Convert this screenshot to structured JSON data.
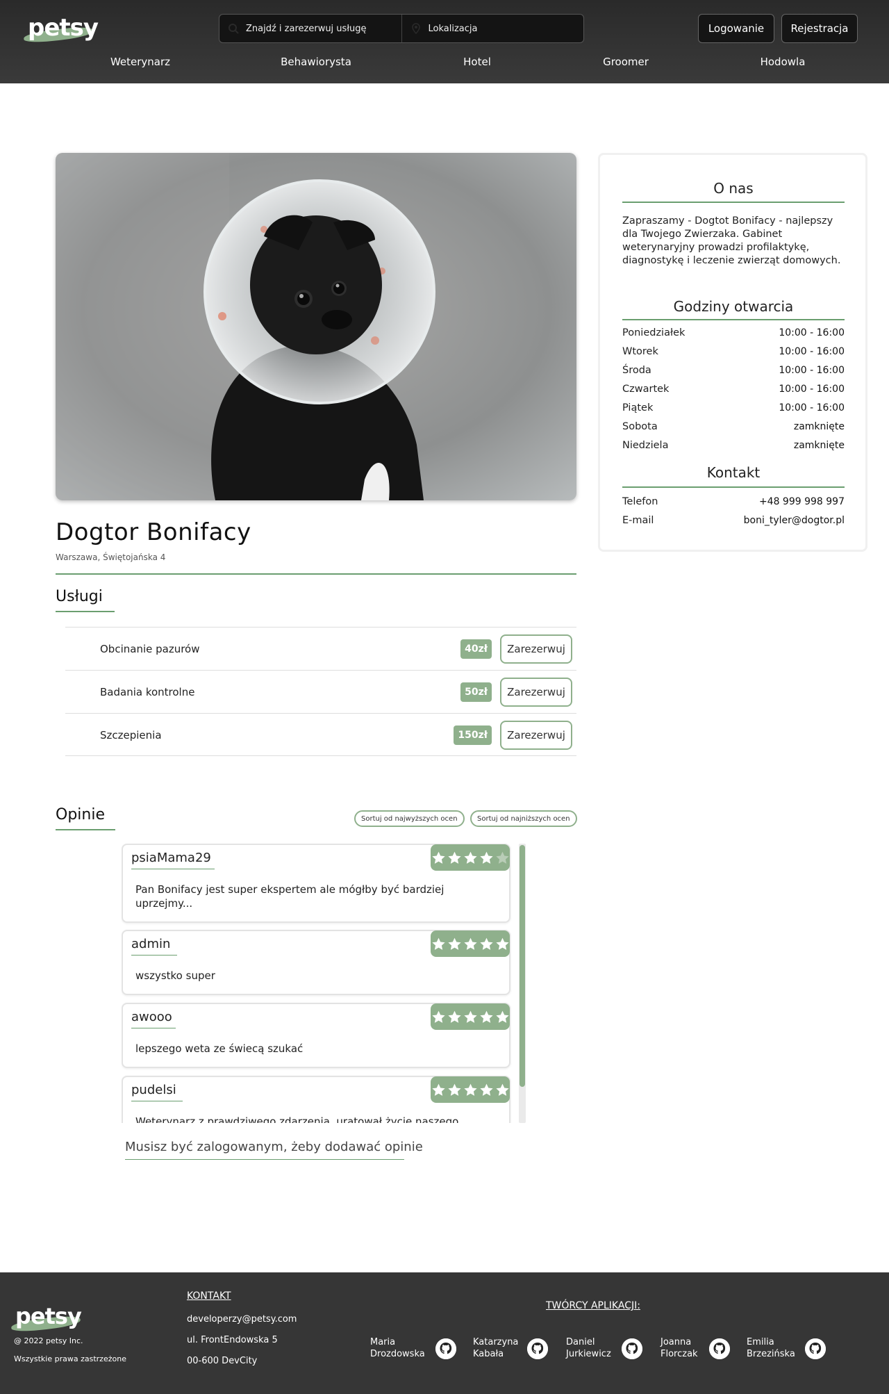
{
  "header": {
    "logo": "petsy",
    "search_placeholder": "Znajdź i zarezerwuj usługę",
    "location_placeholder": "Lokalizacja",
    "login_label": "Logowanie",
    "register_label": "Rejestracja",
    "nav": [
      "Weterynarz",
      "Behawiorysta",
      "Hotel",
      "Groomer",
      "Hodowla"
    ]
  },
  "business": {
    "name": "Dogtor Bonifacy",
    "address": "Warszawa, Świętojańska 4"
  },
  "services": {
    "heading": "Usługi",
    "reserve_label": "Zarezerwuj",
    "items": [
      {
        "name": "Obcinanie pazurów",
        "price": "40zł"
      },
      {
        "name": "Badania kontrolne",
        "price": "50zł"
      },
      {
        "name": "Szczepienia",
        "price": "150zł"
      }
    ]
  },
  "reviews": {
    "heading": "Opinie",
    "sort_high_label": "Sortuj od najwyższych ocen",
    "sort_low_label": "Sortuj od najniższych ocen",
    "items": [
      {
        "user": "psiaMama29",
        "rating": 4,
        "text": "Pan Bonifacy jest super ekspertem ale mógłby być bardziej uprzejmy..."
      },
      {
        "user": "admin",
        "rating": 5,
        "text": "wszystko super"
      },
      {
        "user": "awooo",
        "rating": 5,
        "text": "lepszego weta ze świecą szukać"
      },
      {
        "user": "pudelsi",
        "rating": 5,
        "text": "Weterynarz z prawdziwego zdarzenia, uratował życie naszego"
      }
    ],
    "login_note": "Musisz być zalogowanym, żeby dodawać opinie"
  },
  "sidebar": {
    "about_heading": "O nas",
    "about_text": "Zapraszamy - Dogtot Bonifacy - najlepszy dla Twojego Zwierzaka. Gabinet weterynaryjny prowadzi profilaktykę, diagnostykę i leczenie zwierząt domowych.",
    "hours_heading": "Godziny otwarcia",
    "hours": [
      {
        "day": "Poniedziałek",
        "time": "10:00 - 16:00"
      },
      {
        "day": "Wtorek",
        "time": "10:00 - 16:00"
      },
      {
        "day": "Środa",
        "time": "10:00 - 16:00"
      },
      {
        "day": "Czwartek",
        "time": "10:00 - 16:00"
      },
      {
        "day": "Piątek",
        "time": "10:00 - 16:00"
      },
      {
        "day": "Sobota",
        "time": "zamknięte"
      },
      {
        "day": "Niedziela",
        "time": "zamknięte"
      }
    ],
    "contact_heading": "Kontakt",
    "contact": [
      {
        "label": "Telefon",
        "value": "+48 999 998 997"
      },
      {
        "label": "E-mail",
        "value": "boni_tyler@dogtor.pl"
      }
    ]
  },
  "footer": {
    "logo": "petsy",
    "copyright": "@ 2022 petsy Inc.",
    "rights": "Wszystkie prawa zastrzeżone",
    "contact_heading": "KONTAKT",
    "email": "developerzy@petsy.com",
    "street": "ul. FrontEndowska 5",
    "city": "00-600 DevCity",
    "creators_heading": "TWÓRCY APLIKACJI:",
    "creators": [
      {
        "first": "Maria",
        "last": "Drozdowska"
      },
      {
        "first": "Katarzyna",
        "last": "Kabała"
      },
      {
        "first": "Daniel",
        "last": "Jurkiewicz"
      },
      {
        "first": "Joanna",
        "last": "Florczak"
      },
      {
        "first": "Emilia",
        "last": "Brzezińska"
      }
    ]
  },
  "colors": {
    "accent": "#8fb08c",
    "rule": "#6a9e6f",
    "header_bg": "#2f2f2f",
    "footer_bg": "#363636"
  },
  "icons": [
    "search-icon",
    "location-pin-icon",
    "star-icon",
    "github-icon"
  ]
}
